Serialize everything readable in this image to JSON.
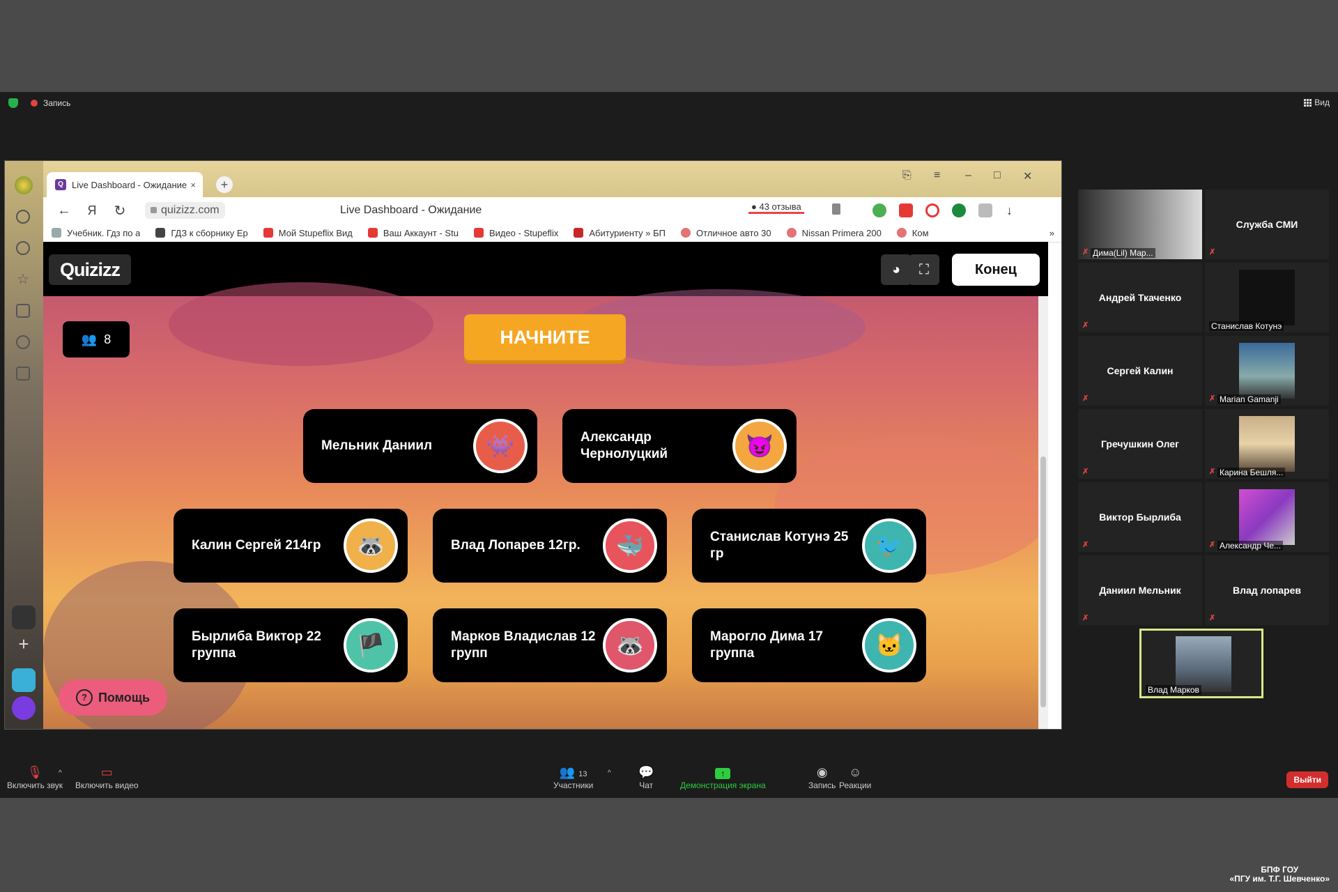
{
  "zoom": {
    "recording_label": "Запись",
    "view_label": "Вид"
  },
  "browser": {
    "tab_title": "Live Dashboard - Ожидание",
    "tab_favicon": "Q",
    "url": "quizizz.com",
    "page_title": "Live Dashboard - Ожидание",
    "yandex_letter": "Я",
    "reviews": "43 отзыва",
    "bookmarks": [
      {
        "label": "Учебник. Гдз по а"
      },
      {
        "label": "ГДЗ к сборнику Ер"
      },
      {
        "label": "Мой Stupeflix Вид"
      },
      {
        "label": "Ваш Аккаунт - Stu"
      },
      {
        "label": "Видео - Stupeflix"
      },
      {
        "label": "Абитуриенту » БП"
      },
      {
        "label": "Отличное авто 30"
      },
      {
        "label": "Nissan Primera 200"
      },
      {
        "label": "Ком"
      }
    ]
  },
  "quizizz": {
    "logo": "Quizizz",
    "end_button": "Конец",
    "players_count": "8",
    "start_button": "НАЧНИТЕ",
    "help_button": "Помощь",
    "players": [
      {
        "name": "Мельник Даниил",
        "avatar": "monster-red-icon"
      },
      {
        "name": "Александр Чернолуцкий",
        "avatar": "monster-orange-icon"
      },
      {
        "name": "Калин Сергей 214гр",
        "avatar": "raccoon-icon"
      },
      {
        "name": "Влад Лопарев 12гр.",
        "avatar": "zoop-icon"
      },
      {
        "name": "Станислав Котунэ 25 гр",
        "avatar": "bird-icon"
      },
      {
        "name": "Бырлиба Виктор 22 группа",
        "avatar": "pirate-icon"
      },
      {
        "name": "Марков Владислав 12 групп",
        "avatar": "raccoon-icon"
      },
      {
        "name": "Марогло Дима 17 группа",
        "avatar": "cat-icon"
      }
    ]
  },
  "gallery": {
    "participants": [
      {
        "name": "Дима(Lil) Мар...",
        "has_video": true
      },
      {
        "name": "Служба СМИ",
        "has_video": false
      },
      {
        "name": "Андрей Ткаченко",
        "has_video": false
      },
      {
        "name": "Станислав Котунэ",
        "has_video": true
      },
      {
        "name": "Сергей Калин",
        "has_video": false
      },
      {
        "name": "Marian Gamanji",
        "has_video": true
      },
      {
        "name": "Гречушкин Олег",
        "has_video": false
      },
      {
        "name": "Карина Бешля...",
        "has_video": true
      },
      {
        "name": "Виктор Бырлиба",
        "has_video": false
      },
      {
        "name": "Александр Че...",
        "has_video": true
      },
      {
        "name": "Даниил Мельник",
        "has_video": false
      },
      {
        "name": "Влад лопарев",
        "has_video": false
      },
      {
        "name": "Влад Марков",
        "has_video": true
      }
    ]
  },
  "toolbar": {
    "unmute": "Включить звук",
    "start_video": "Включить видео",
    "participants": "Участники",
    "participants_count": "13",
    "chat": "Чат",
    "share_screen": "Демонстрация экрана",
    "record": "Запись",
    "reactions": "Реакции",
    "leave": "Выйти"
  },
  "watermark": {
    "line1": "БПФ ГОУ",
    "line2": "«ПГУ им. Т.Г. Шевченко»"
  },
  "colors": {
    "start_button": "#f5a623",
    "help_button": "#ec5c7d",
    "share_screen": "#2ecc40",
    "leave": "#d32e2e"
  }
}
